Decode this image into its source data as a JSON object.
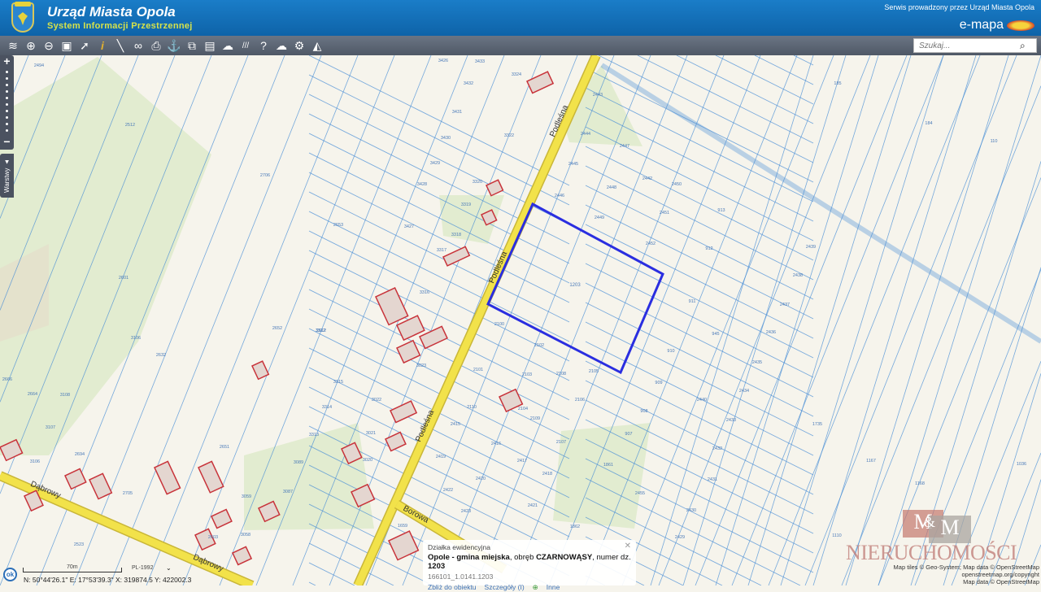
{
  "header": {
    "title": "Urząd Miasta Opola",
    "subtitle": "System Informacji Przestrzennej",
    "service_text": "Serwis prowadzony przez Urząd Miasta Opola",
    "brand": "e-mapa"
  },
  "toolbar": {
    "icons": [
      "layers-icon",
      "zoom-in-icon",
      "zoom-out-icon",
      "zoom-extent-icon",
      "select-arrow-icon",
      "info-icon",
      "measure-icon",
      "link-icon",
      "print-icon",
      "download-icon",
      "overlay-icon",
      "layout-icon",
      "shape-icon",
      "hatch-icon",
      "help-icon",
      "cloud-icon",
      "settings-icon",
      "sail-icon"
    ],
    "search_placeholder": "Szukaj..."
  },
  "map_controls": {
    "zoom_in": "+",
    "zoom_out": "−",
    "layers_label": "Warstwy"
  },
  "colors": {
    "parcel_line": "#4a8fd6",
    "selected_parcel": "#2a2ee0",
    "road": "#f2e24a",
    "green": "#e2ecd0",
    "building": "#c8333a",
    "header": "#1670bd"
  },
  "roads": [
    "Podleśna",
    "Podleśna",
    "Podleśna",
    "Dąbrowy",
    "Dąbrowy",
    "Borowa"
  ],
  "selected_parcel_label": "1203",
  "parcel_labels": [
    "3426",
    "3433",
    "3324",
    "3432",
    "3431",
    "3322",
    "3430",
    "3429",
    "3320",
    "3428",
    "3319",
    "3427",
    "3318",
    "3317",
    "3316",
    "3315",
    "3314",
    "3313",
    "3023",
    "3022",
    "3021",
    "3020",
    "2443",
    "2444",
    "2445",
    "2446",
    "2447",
    "2448",
    "2449",
    "2450",
    "2451",
    "2452",
    "2442",
    "913",
    "912",
    "911",
    "910",
    "909",
    "908",
    "907",
    "2100",
    "2102",
    "2101",
    "2103",
    "2108",
    "2105",
    "2106",
    "2104",
    "2110",
    "2109",
    "2415",
    "2416",
    "2419",
    "2417",
    "2418",
    "2420",
    "2421",
    "2422",
    "2423",
    "2107",
    "1861",
    "1862",
    "2439",
    "2438",
    "2437",
    "2436",
    "2435",
    "2434",
    "2433",
    "2432",
    "2431",
    "2430",
    "2429",
    "1735",
    "1167",
    "1168",
    "1110",
    "1036",
    "185",
    "184",
    "110",
    "2494",
    "2512",
    "2706",
    "2653",
    "2652",
    "2612",
    "2651",
    "2632",
    "2601",
    "3106",
    "2666",
    "2664",
    "3108",
    "3107",
    "3106",
    "2694",
    "2705",
    "2603",
    "3089",
    "3087",
    "3059",
    "3058",
    "1659",
    "2523",
    "945",
    "2455",
    "2440",
    "3312"
  ],
  "popup": {
    "heading": "Działka ewidencyjna",
    "municipality": "Opole - gmina miejska",
    "precinct_prefix": ", obręb ",
    "precinct": "CZARNOWĄSY",
    "number_prefix": ", numer dz. ",
    "number": "1203",
    "id": "166101_1.0141.1203",
    "link_zoom": "Zbliż do obiektu",
    "link_details": "Szczegóły (I)",
    "link_other": "Inne"
  },
  "statusbar": {
    "ok": "ok",
    "scale": "70m",
    "projection": "PL-1992",
    "coords": "N: 50°44'26.1\"  E: 17°53'39.3\"  X: 319874.5  Y: 422002.3"
  },
  "watermark": {
    "m1": "M",
    "amp": "&",
    "m2": "M",
    "text": "NIERUCHOMOŚCI"
  },
  "attribution": {
    "line1": "Map tiles © Geo-System; Map data © OpenStreetMap",
    "line2": "openstreetmap.org/copyright",
    "line3": "Map data © OpenStreetMap"
  }
}
